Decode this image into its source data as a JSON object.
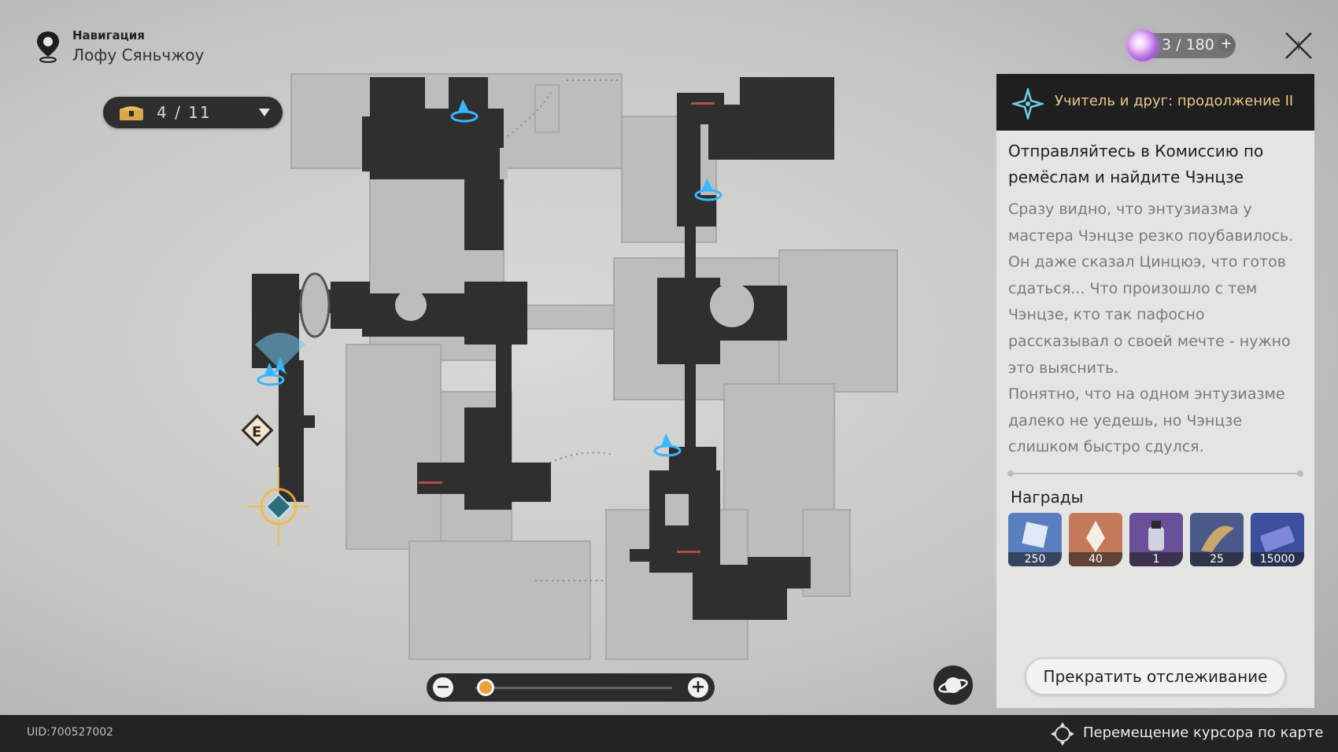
{
  "navigation": {
    "caption": "Навигация",
    "location": "Лофу Сяньчжоу"
  },
  "chest_counter": {
    "value": "4 / 11"
  },
  "stamina": {
    "value": "3 / 180"
  },
  "quest": {
    "title": "Учитель и друг: продолжение II",
    "objective": "Отправляйтесь в Комиссию по ремёслам и найдите Чэнцзе",
    "description": "Сразу видно, что энтузиазма у мастера Чэнцзе резко поубавилось. Он даже сказал Цинцюэ, что готов сдаться... Что произошло с тем Чэнцзе, кто так пафосно рассказывал о своей мечте - нужно это выяснить.\nПонятно, что на одном энтузиазме далеко не уедешь, но Чэнцзе слишком быстро сдулся.",
    "rewards_label": "Награды",
    "rewards": [
      {
        "amount": "250",
        "icon": "trailblaze-exp-icon",
        "color": "#5a7fc0"
      },
      {
        "amount": "40",
        "icon": "stellar-jade-icon",
        "color": "#c47a5a"
      },
      {
        "amount": "1",
        "icon": "potion-icon",
        "color": "#6a4f9a"
      },
      {
        "amount": "25",
        "icon": "material-icon",
        "color": "#4a5a8a"
      },
      {
        "amount": "15000",
        "icon": "credits-icon",
        "color": "#3b4f9c"
      }
    ],
    "stop_tracking_label": "Прекратить отслеживание"
  },
  "footer": {
    "uid": "UID:700527002",
    "hint": "Перемещение курсора по карте"
  },
  "zoom": {
    "minus": "−",
    "plus": "+",
    "level": 0.05
  },
  "colors": {
    "accent_gold": "#e9c88a",
    "marker_blue": "#3ab6ff",
    "dark_ui": "#2c2c2c"
  }
}
